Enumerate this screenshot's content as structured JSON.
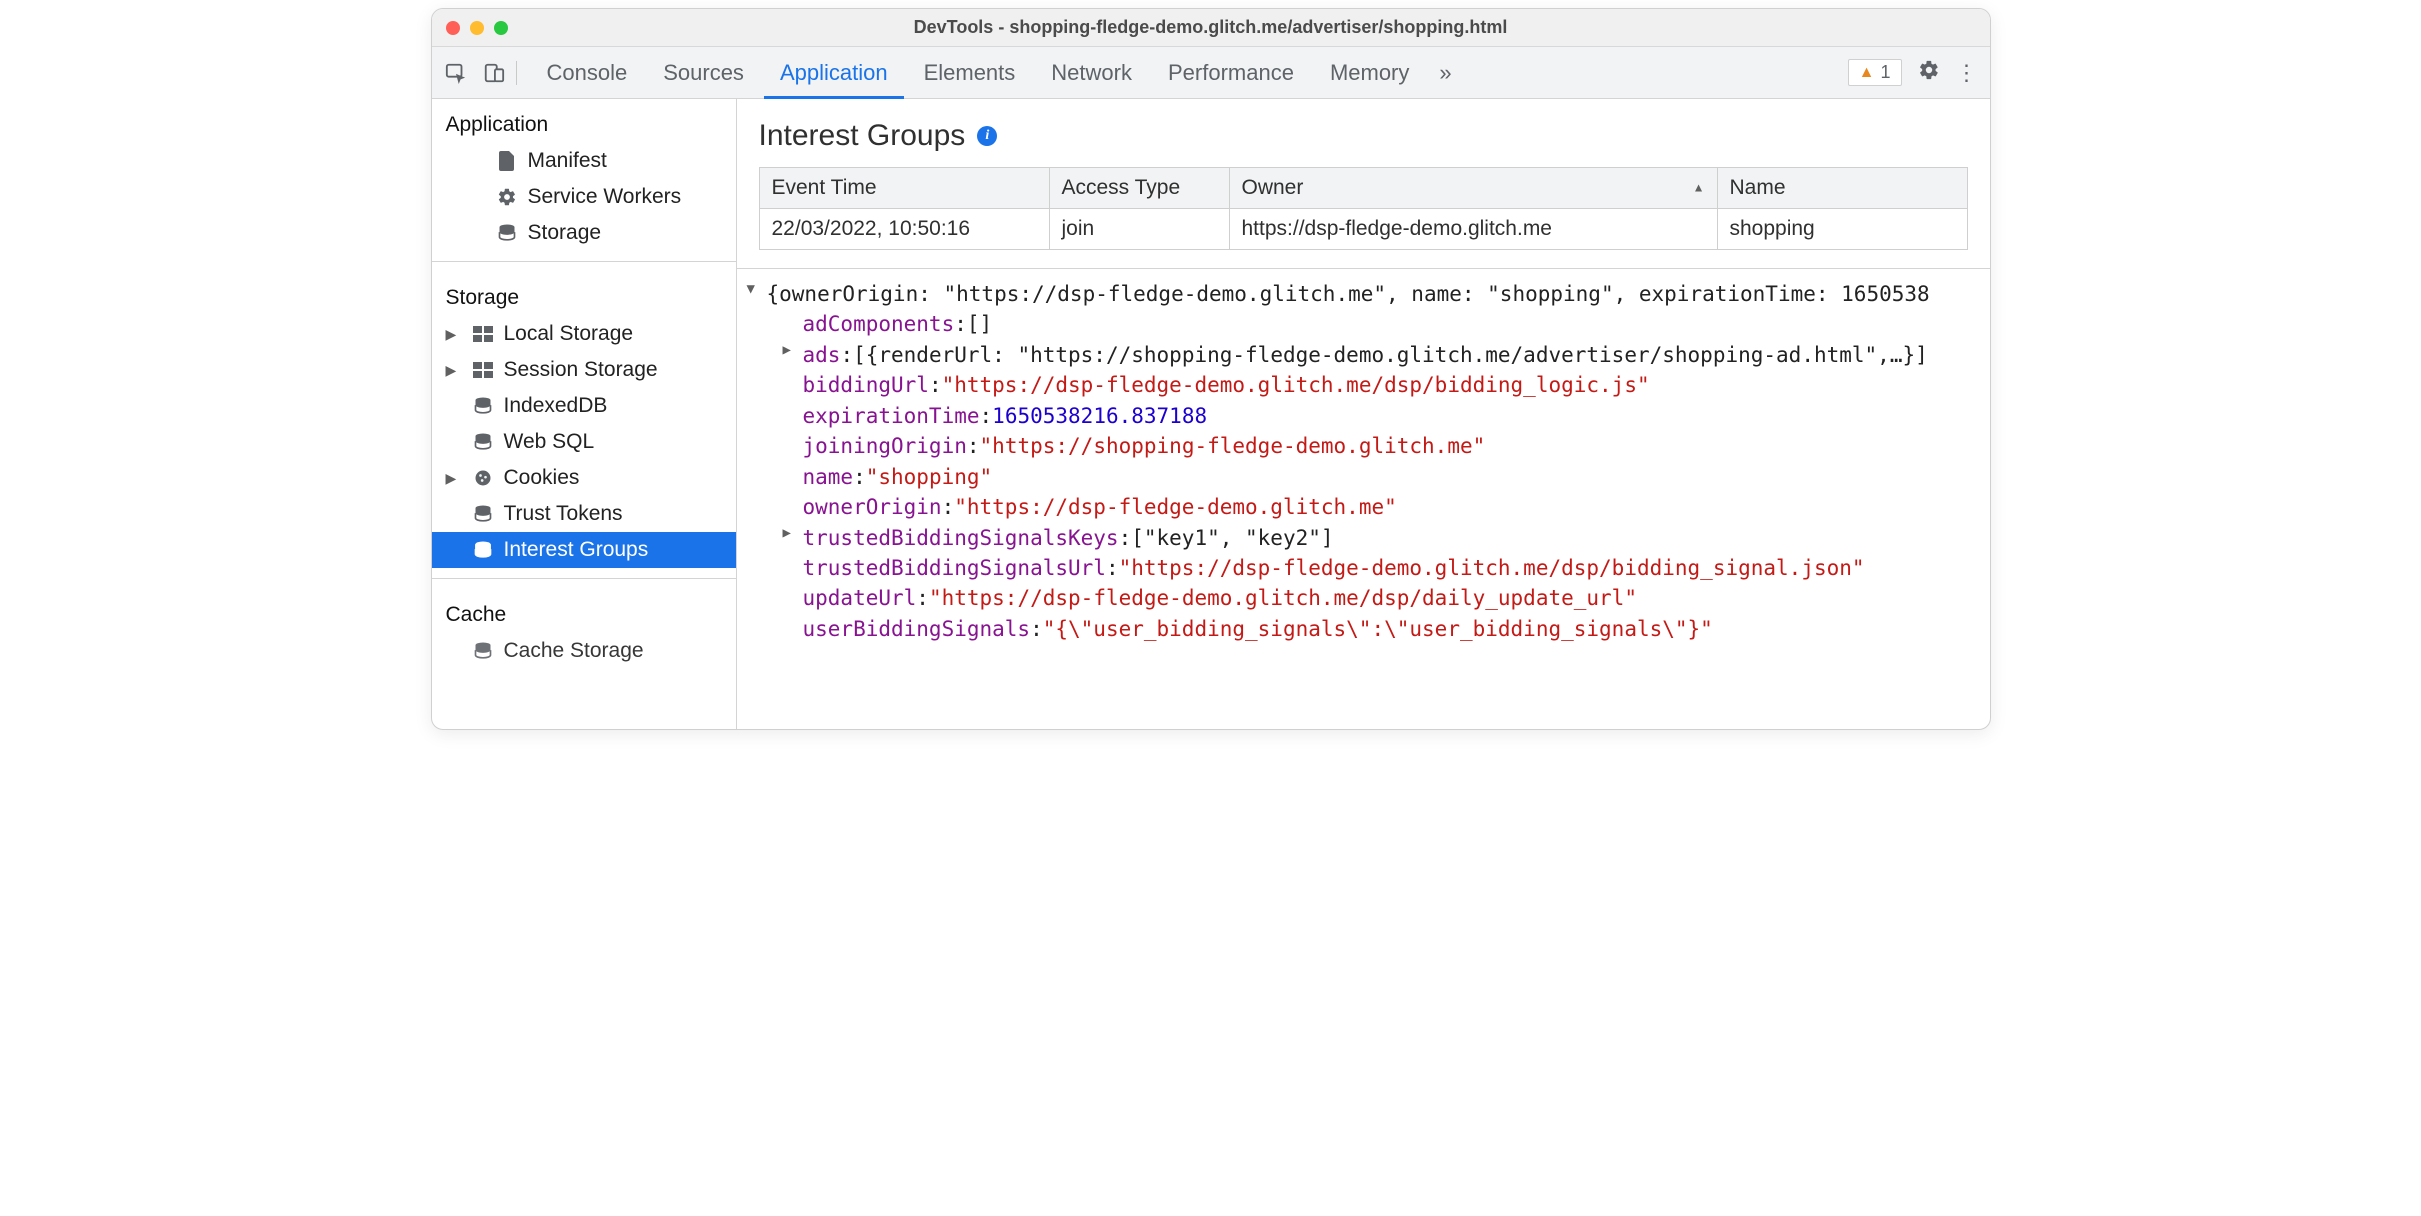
{
  "window": {
    "title": "DevTools - shopping-fledge-demo.glitch.me/advertiser/shopping.html"
  },
  "tabs": {
    "items": [
      "Console",
      "Sources",
      "Application",
      "Elements",
      "Network",
      "Performance",
      "Memory"
    ],
    "active": "Application",
    "warnings": "1"
  },
  "sidebar": {
    "sections": {
      "application": {
        "title": "Application",
        "items": [
          {
            "icon": "file",
            "label": "Manifest"
          },
          {
            "icon": "gear",
            "label": "Service Workers"
          },
          {
            "icon": "db",
            "label": "Storage"
          }
        ]
      },
      "storage": {
        "title": "Storage",
        "items": [
          {
            "icon": "grid",
            "label": "Local Storage",
            "expandable": true
          },
          {
            "icon": "grid",
            "label": "Session Storage",
            "expandable": true
          },
          {
            "icon": "db",
            "label": "IndexedDB"
          },
          {
            "icon": "db",
            "label": "Web SQL"
          },
          {
            "icon": "cookie",
            "label": "Cookies",
            "expandable": true
          },
          {
            "icon": "db",
            "label": "Trust Tokens"
          },
          {
            "icon": "db",
            "label": "Interest Groups",
            "selected": true
          }
        ]
      },
      "cache": {
        "title": "Cache",
        "items": [
          {
            "icon": "db",
            "label": "Cache Storage"
          }
        ]
      }
    }
  },
  "panel": {
    "heading": "Interest Groups",
    "table": {
      "columns": [
        "Event Time",
        "Access Type",
        "Owner",
        "Name"
      ],
      "sort_column": 2,
      "rows": [
        {
          "c0": "22/03/2022, 10:50:16",
          "c1": "join",
          "c2": "https://dsp-fledge-demo.glitch.me",
          "c3": "shopping"
        }
      ]
    },
    "details": {
      "header": "{ownerOrigin: \"https://dsp-fledge-demo.glitch.me\", name: \"shopping\", expirationTime: 1650538",
      "lines": [
        {
          "key": "adComponents",
          "raw": "[]"
        },
        {
          "key": "ads",
          "expandable": true,
          "raw": "[{renderUrl: \"https://shopping-fledge-demo.glitch.me/advertiser/shopping-ad.html\",…}]"
        },
        {
          "key": "biddingUrl",
          "str": "\"https://dsp-fledge-demo.glitch.me/dsp/bidding_logic.js\""
        },
        {
          "key": "expirationTime",
          "num": "1650538216.837188"
        },
        {
          "key": "joiningOrigin",
          "str": "\"https://shopping-fledge-demo.glitch.me\""
        },
        {
          "key": "name",
          "str": "\"shopping\""
        },
        {
          "key": "ownerOrigin",
          "str": "\"https://dsp-fledge-demo.glitch.me\""
        },
        {
          "key": "trustedBiddingSignalsKeys",
          "expandable": true,
          "raw": "[\"key1\", \"key2\"]"
        },
        {
          "key": "trustedBiddingSignalsUrl",
          "str": "\"https://dsp-fledge-demo.glitch.me/dsp/bidding_signal.json\""
        },
        {
          "key": "updateUrl",
          "str": "\"https://dsp-fledge-demo.glitch.me/dsp/daily_update_url\""
        },
        {
          "key": "userBiddingSignals",
          "str": "\"{\\\"user_bidding_signals\\\":\\\"user_bidding_signals\\\"}\""
        }
      ]
    }
  }
}
